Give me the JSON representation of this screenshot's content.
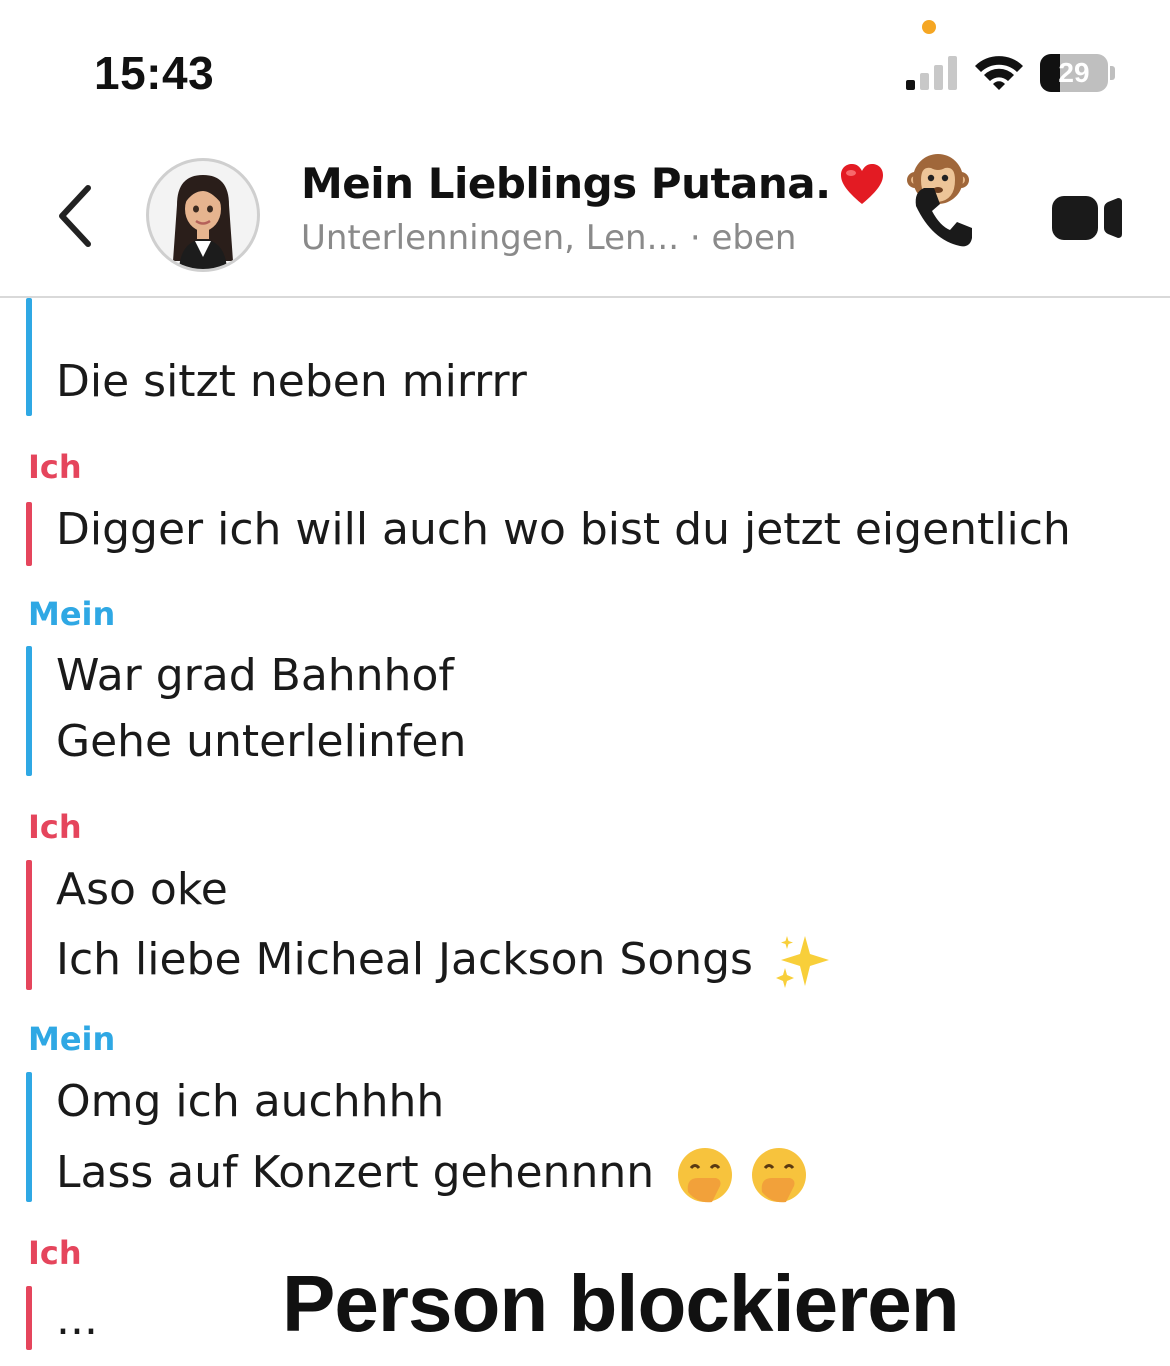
{
  "status_bar": {
    "time": "15:43",
    "battery": "29",
    "battery_level": 0.29
  },
  "header": {
    "title": "Mein Lieblings Putana.",
    "subtitle": "Unterlenningen, Len... · eben"
  },
  "messages": [
    {
      "sender": "",
      "lines": [
        "Die sitzt neben mirrrr"
      ]
    },
    {
      "sender": "Ich",
      "lines": [
        "Digger ich will auch wo bist du jetzt eigentlich"
      ]
    },
    {
      "sender": "Mein",
      "lines": [
        "War grad Bahnhof",
        "Gehe unterlelinfen"
      ]
    },
    {
      "sender": "Ich",
      "lines": [
        "Aso oke",
        "Ich liebe Micheal Jackson Songs"
      ]
    },
    {
      "sender": "Mein",
      "lines": [
        "Omg ich auchhhh",
        "Lass auf Konzert gehennnn"
      ]
    },
    {
      "sender": "Ich",
      "lines": [
        "..."
      ]
    }
  ],
  "overlay_text": "Person blockieren",
  "colors": {
    "me": "#e5455c",
    "friend": "#2fa8e4"
  },
  "icons": [
    "back-chevron-icon",
    "avatar",
    "red-heart-emoji",
    "monkey-emoji",
    "phone-icon",
    "video-camera-icon",
    "sparkles-emoji",
    "face-with-hand-over-mouth-emoji",
    "tongue-face-emoji"
  ]
}
